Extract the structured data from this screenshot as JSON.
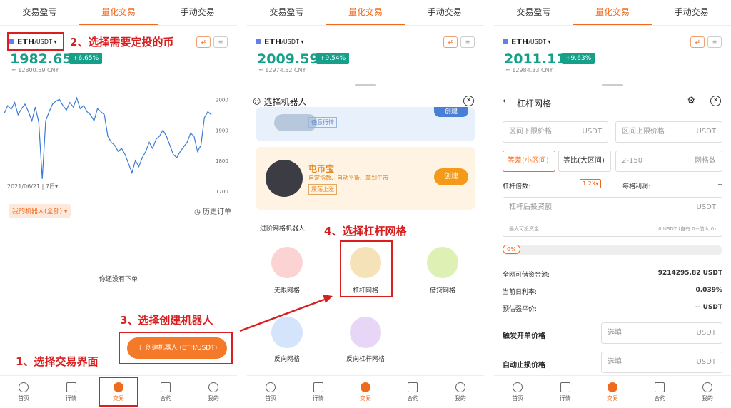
{
  "tabs": [
    "交易盈亏",
    "量化交易",
    "手动交易"
  ],
  "nav": [
    "首页",
    "行情",
    "交易",
    "合约",
    "我的"
  ],
  "p1": {
    "coin": "ETH",
    "pair": "/USDT",
    "price": "1982.65",
    "change": "+6.65%",
    "cny": "≈ 12800.59 CNY",
    "date": "2021/06/21",
    "interval": "7日",
    "ticks": [
      "2000",
      "1900",
      "1800",
      "1700"
    ],
    "my_robots": "我的机器人(全部)",
    "history": "历史订单",
    "empty": "你还没有下单",
    "create_btn": "创建机器人 (ETH/USDT)"
  },
  "annotations": {
    "a1": "1、选择交易界面",
    "a2": "2、选择需要定投的币",
    "a3": "3、选择创建机器人",
    "a4": "4、选择杠杆网格"
  },
  "p2": {
    "price": "2009.59",
    "change": "+9.54%",
    "cny": "≈ 12974.52 CNY",
    "sheet_title": "选择机器人",
    "top_card_tag": "任意行情",
    "top_card_btn": "创建",
    "card_title": "屯币宝",
    "card_desc": "自定指数、自动平衡、拿到牛市",
    "card_tag": "震荡上涨",
    "card_btn": "创建",
    "section": "进阶网格机器人",
    "grids": [
      "无限网格",
      "杠杆网格",
      "借贷网格",
      "反向网格",
      "反向杠杆网格"
    ]
  },
  "p3": {
    "price": "2011.11",
    "change": "+9.63%",
    "cny": "≈ 12984.33 CNY",
    "title": "杠杆网格",
    "lower": "区间下限价格",
    "upper": "区间上限价格",
    "unit": "USDT",
    "mode1": "等差(小区间)",
    "mode2": "等比(大区间)",
    "grid_ph": "2-150",
    "grid_unit": "网格数",
    "leverage_label": "杠杆倍数:",
    "leverage": "1.2X",
    "profit_label": "每格利润:",
    "profit": "--",
    "invest": "杠杆后投资额",
    "max_invest": "最大可投资金",
    "max_val": "0 USDT (自有 0+借入 0)",
    "pct": "0%",
    "pool_label": "全网可借资金池:",
    "pool": "9214295.82 USDT",
    "rate_label": "当前日利率:",
    "rate": "0.039%",
    "liq_label": "预估强平价:",
    "liq": "-- USDT",
    "trigger": "触发开单价格",
    "stop": "自动止损价格",
    "optional": "选填"
  },
  "colors": {
    "accent": "#f06a1d",
    "green": "#16a08a",
    "annotation": "#d81e1e"
  },
  "chart_data": {
    "type": "line",
    "ylim": [
      1700,
      2050
    ],
    "values": [
      1955,
      1980,
      1968,
      1990,
      1950,
      1970,
      1985,
      1960,
      1930,
      1975,
      1925,
      1740,
      1930,
      1960,
      1985,
      1995,
      2000,
      1980,
      1965,
      1990,
      1975,
      2005,
      1970,
      1980,
      1960,
      1950,
      1930,
      1970,
      1960,
      1950,
      1880,
      1860,
      1850,
      1830,
      1840,
      1820,
      1790,
      1760,
      1800,
      1780,
      1810,
      1830,
      1860,
      1840,
      1870,
      1880,
      1900,
      1880,
      1850,
      1820,
      1810,
      1830,
      1845,
      1860,
      1890,
      1880,
      1830,
      1850,
      1940,
      1960,
      1950
    ]
  }
}
